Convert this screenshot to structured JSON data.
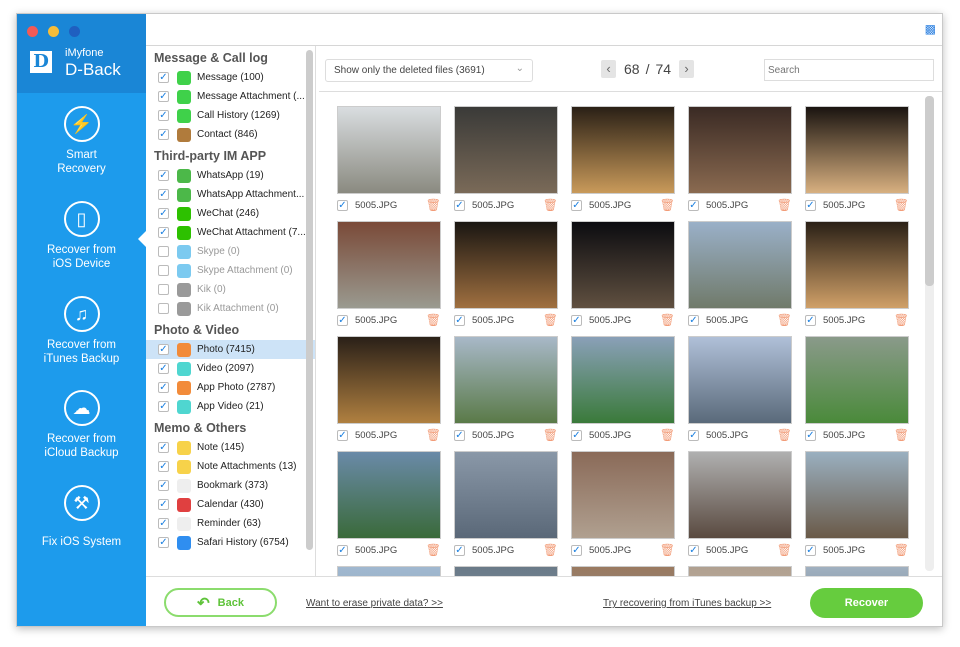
{
  "app": {
    "brand_small": "iMyfone",
    "brand_large": "D-Back",
    "logo_letter": "D"
  },
  "sidebar": [
    {
      "label1": "Smart",
      "label2": "Recovery",
      "icon": "lightning-icon"
    },
    {
      "label1": "Recover from",
      "label2": "iOS Device",
      "icon": "iphone-icon",
      "active": true
    },
    {
      "label1": "Recover from",
      "label2": "iTunes Backup",
      "icon": "music-note-icon"
    },
    {
      "label1": "Recover from",
      "label2": "iCloud Backup",
      "icon": "cloud-icon"
    },
    {
      "label1": "Fix iOS System",
      "label2": "",
      "icon": "wrench-icon"
    }
  ],
  "categories": [
    {
      "title": "Message & Call log",
      "items": [
        {
          "label": "Message (100)",
          "checked": true,
          "color": "#3fd14a"
        },
        {
          "label": "Message Attachment (...",
          "checked": true,
          "color": "#3fd14a"
        },
        {
          "label": "Call History (1269)",
          "checked": true,
          "color": "#3fd14a"
        },
        {
          "label": "Contact (846)",
          "checked": true,
          "color": "#b07b3c"
        }
      ]
    },
    {
      "title": "Third-party IM APP",
      "items": [
        {
          "label": "WhatsApp (19)",
          "checked": true,
          "color": "#4cb849"
        },
        {
          "label": "WhatsApp Attachment...",
          "checked": true,
          "color": "#4cb849"
        },
        {
          "label": "WeChat (246)",
          "checked": true,
          "color": "#2dc100"
        },
        {
          "label": "WeChat Attachment (7...",
          "checked": true,
          "color": "#2dc100"
        },
        {
          "label": "Skype (0)",
          "checked": false,
          "color": "#7ccaf0",
          "disabled": true
        },
        {
          "label": "Skype Attachment (0)",
          "checked": false,
          "color": "#7ccaf0",
          "disabled": true
        },
        {
          "label": "Kik (0)",
          "checked": false,
          "color": "#9a9a9a",
          "disabled": true
        },
        {
          "label": "Kik Attachment (0)",
          "checked": false,
          "color": "#9a9a9a",
          "disabled": true
        }
      ]
    },
    {
      "title": "Photo & Video",
      "items": [
        {
          "label": "Photo (7415)",
          "checked": true,
          "color": "#f28b3a",
          "selected": true
        },
        {
          "label": "Video (2097)",
          "checked": true,
          "color": "#4fd6d0"
        },
        {
          "label": "App Photo (2787)",
          "checked": true,
          "color": "#f28b3a"
        },
        {
          "label": "App Video (21)",
          "checked": true,
          "color": "#4fd6d0"
        }
      ]
    },
    {
      "title": "Memo & Others",
      "items": [
        {
          "label": "Note (145)",
          "checked": true,
          "color": "#f7d24a"
        },
        {
          "label": "Note Attachments (13)",
          "checked": true,
          "color": "#f7d24a"
        },
        {
          "label": "Bookmark (373)",
          "checked": true,
          "color": "#eeeeee"
        },
        {
          "label": "Calendar (430)",
          "checked": true,
          "color": "#e04040"
        },
        {
          "label": "Reminder (63)",
          "checked": true,
          "color": "#eeeeee"
        },
        {
          "label": "Safari History (6754)",
          "checked": true,
          "color": "#2f8ef0"
        }
      ]
    }
  ],
  "toolbar": {
    "filter": "Show only the deleted files (3691)",
    "page_current": "68",
    "page_sep": "/",
    "page_total": "74",
    "search_placeholder": "Search"
  },
  "thumbnails": {
    "filename": "5005.JPG",
    "tones": [
      [
        "#d9dde0",
        "#8a8a80"
      ],
      [
        "#3a3a38",
        "#7a6a58"
      ],
      [
        "#2a2016",
        "#c99a5a"
      ],
      [
        "#3a2a24",
        "#8a6a50"
      ],
      [
        "#1a1410",
        "#d8b080"
      ],
      [
        "#7a4a38",
        "#9a9a90"
      ],
      [
        "#1a1612",
        "#a07040"
      ],
      [
        "#0c0c10",
        "#605040"
      ],
      [
        "#9ab0c8",
        "#707a6a"
      ],
      [
        "#2a2016",
        "#d0a068"
      ],
      [
        "#2a2018",
        "#b08040"
      ],
      [
        "#a8b8c8",
        "#5a7a48"
      ],
      [
        "#8aa0b8",
        "#3a7a3a"
      ],
      [
        "#b0c0d8",
        "#5a6a7a"
      ],
      [
        "#8a9a8a",
        "#4a8a3a"
      ],
      [
        "#6a8aa8",
        "#3a6a3a"
      ],
      [
        "#8a98a8",
        "#5a6878"
      ],
      [
        "#8a6a58",
        "#b0a090"
      ],
      [
        "#b0b0b0",
        "#5a4a40"
      ],
      [
        "#9ab0c0",
        "#6a5a48"
      ],
      [
        "#a0b8d0",
        "#8a9aa8"
      ],
      [
        "#6a7a88",
        "#8a9aa8"
      ],
      [
        "#9a7a60",
        "#7a8a98"
      ],
      [
        "#b0a090",
        "#d0c0b0"
      ],
      [
        "#a0b0c0",
        "#6a7a80"
      ]
    ]
  },
  "footer": {
    "back": "Back",
    "erase_link": "Want to erase private data? >>",
    "itunes_link": "Try recovering from iTunes backup >>",
    "recover": "Recover"
  }
}
